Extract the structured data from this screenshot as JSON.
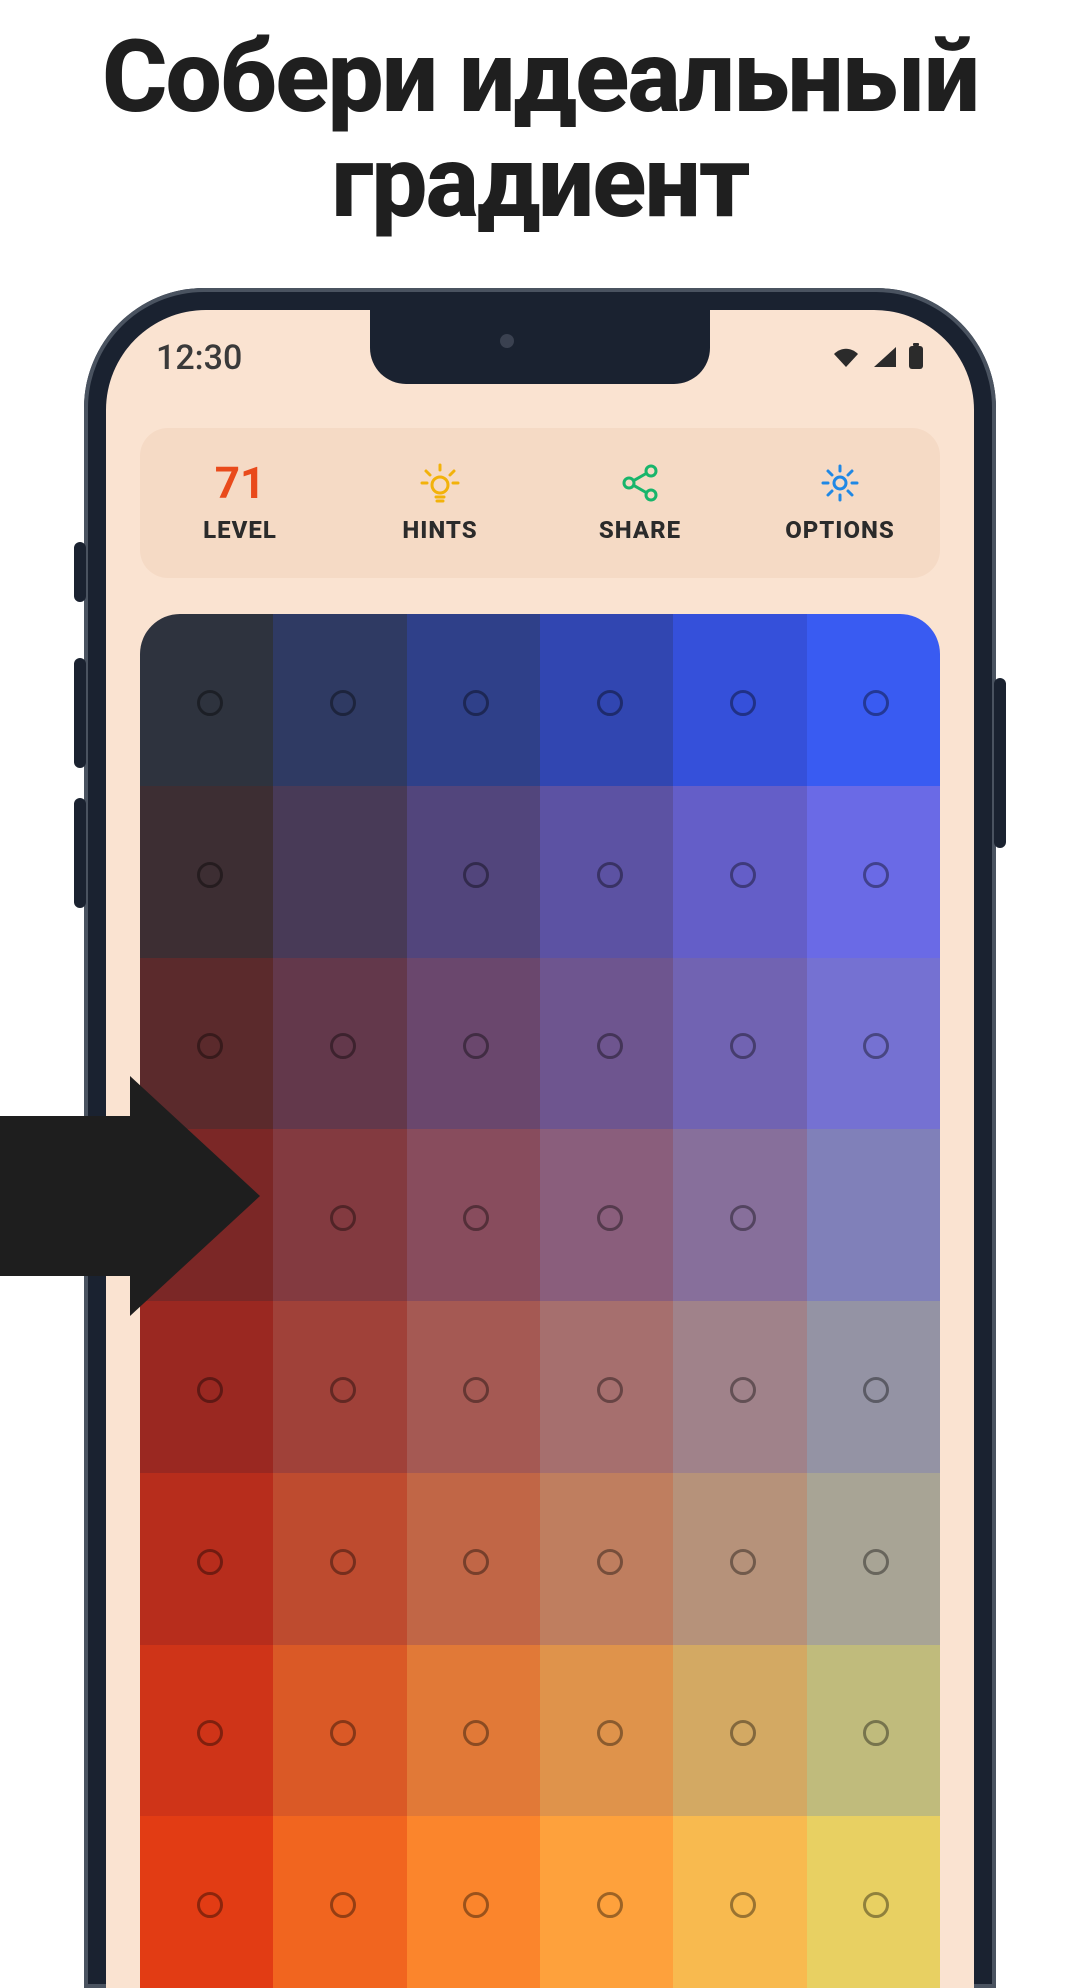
{
  "headline": {
    "line1": "Собери идеальный",
    "line2": "градиент"
  },
  "statusbar": {
    "time": "12:30",
    "icons": {
      "wifi": "wifi-icon",
      "signal": "cell-signal-icon",
      "battery": "battery-icon"
    }
  },
  "toolbar": {
    "level": {
      "value": "71",
      "label": "LEVEL",
      "color": "#e94a1b"
    },
    "hints": {
      "label": "HINTS",
      "icon": "lightbulb-icon",
      "iconColor": "#f2b20a"
    },
    "share": {
      "label": "SHARE",
      "icon": "share-icon",
      "iconColor": "#18b56b"
    },
    "options": {
      "label": "OPTIONS",
      "icon": "gear-icon",
      "iconColor": "#1f88e5"
    }
  },
  "board": {
    "cols": 6,
    "rows": 8,
    "grid": [
      [
        "#2e333e",
        "#2f3a63",
        "#2f4089",
        "#3146b1",
        "#3550da",
        "#395bf2"
      ],
      [
        "#3d2e33",
        "#483a57",
        "#52457c",
        "#5c52a3",
        "#645ec8",
        "#6a6ae6"
      ],
      [
        "#5b2a2c",
        "#63384b",
        "#6a476d",
        "#6e558f",
        "#7163b2",
        "#7571d2"
      ],
      [
        "#7b2726",
        "#833a40",
        "#884c5d",
        "#8a5e7c",
        "#876f9b",
        "#8080b9"
      ],
      [
        "#9a2821",
        "#a04139",
        "#a55953",
        "#a66f6e",
        "#a0828a",
        "#9493a4"
      ],
      [
        "#b72d1c",
        "#be4b2f",
        "#c16646",
        "#bf7e5f",
        "#b6927a",
        "#a8a495"
      ],
      [
        "#cf3418",
        "#da5926",
        "#e17937",
        "#df934b",
        "#d3a963",
        "#c0bb7c"
      ],
      [
        "#e23c14",
        "#f1651f",
        "#fb852c",
        "#fea13c",
        "#f8ba4f",
        "#e8d062"
      ]
    ],
    "cellsWithoutDot": [
      [
        1,
        1
      ],
      [
        3,
        5
      ]
    ]
  }
}
